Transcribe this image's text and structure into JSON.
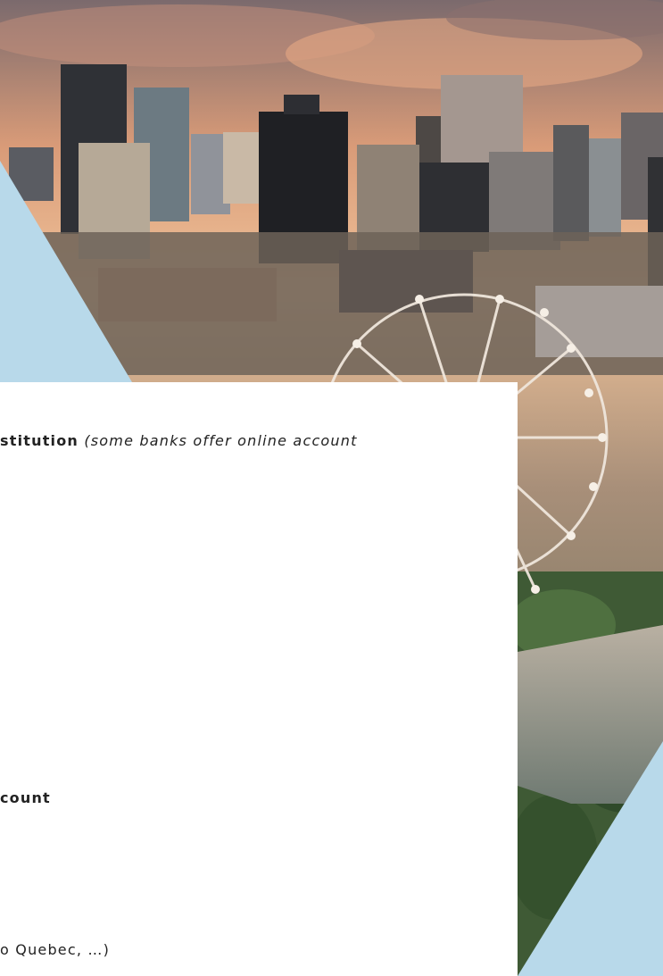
{
  "card": {
    "line1": {
      "bold": "stitution",
      "italic": "(some banks offer online account"
    },
    "line2": {
      "bold": "count"
    },
    "line3": {
      "text": "o Quebec, …)"
    }
  },
  "colors": {
    "accent_blue": "#b8d9ea",
    "card_bg": "#ffffff",
    "sky_top": "#e8b48a",
    "sky_bottom": "#f2c8a0"
  },
  "image": {
    "alt": "Montreal skyline at sunset with Ferris wheel"
  }
}
